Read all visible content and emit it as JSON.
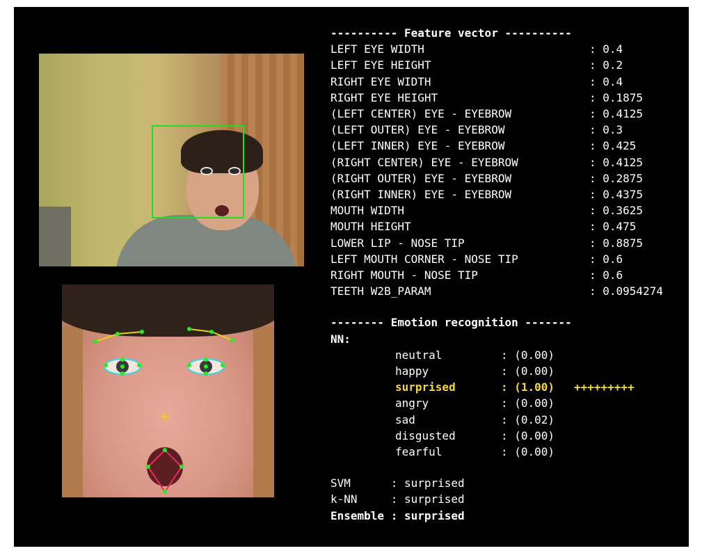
{
  "feature_header": "---------- Feature vector ----------",
  "features": [
    {
      "label": "LEFT EYE WIDTH",
      "value": "0.4"
    },
    {
      "label": "LEFT EYE HEIGHT",
      "value": "0.2"
    },
    {
      "label": "RIGHT EYE WIDTH",
      "value": "0.4"
    },
    {
      "label": "RIGHT EYE HEIGHT",
      "value": "0.1875"
    },
    {
      "label": "(LEFT CENTER) EYE - EYEBROW",
      "value": "0.4125"
    },
    {
      "label": "(LEFT OUTER) EYE - EYEBROW",
      "value": "0.3"
    },
    {
      "label": "(LEFT INNER) EYE - EYEBROW",
      "value": "0.425"
    },
    {
      "label": "(RIGHT CENTER) EYE - EYEBROW",
      "value": "0.4125"
    },
    {
      "label": "(RIGHT OUTER) EYE - EYEBROW",
      "value": "0.2875"
    },
    {
      "label": "(RIGHT INNER) EYE - EYEBROW",
      "value": "0.4375"
    },
    {
      "label": "MOUTH WIDTH",
      "value": "0.3625"
    },
    {
      "label": "MOUTH HEIGHT",
      "value": "0.475"
    },
    {
      "label": "LOWER LIP - NOSE TIP",
      "value": "0.8875"
    },
    {
      "label": "LEFT MOUTH CORNER - NOSE TIP",
      "value": "0.6"
    },
    {
      "label": "RIGHT MOUTH - NOSE TIP",
      "value": "0.6"
    },
    {
      "label": "TEETH W2B_PARAM",
      "value": "0.0954274"
    }
  ],
  "value_prefix": ": ",
  "emotion_header": "-------- Emotion recognition -------",
  "nn_label": "NN:",
  "emotions": [
    {
      "label": "neutral",
      "value": ": (0.00)",
      "bar": ""
    },
    {
      "label": "happy",
      "value": ": (0.00)",
      "bar": ""
    },
    {
      "label": "surprised",
      "value": ": (1.00)",
      "bar": "+++++++++"
    },
    {
      "label": "angry",
      "value": ": (0.00)",
      "bar": ""
    },
    {
      "label": "sad",
      "value": ": (0.02)",
      "bar": ""
    },
    {
      "label": "disgusted",
      "value": ": (0.00)",
      "bar": ""
    },
    {
      "label": "fearful",
      "value": ": (0.00)",
      "bar": ""
    }
  ],
  "highlight_index": 2,
  "results": [
    {
      "text": "SVM      : surprised"
    },
    {
      "text": "k-NN     : surprised"
    },
    {
      "text": "Ensemble : surprised"
    }
  ],
  "colors": {
    "highlight": "#f5d63b",
    "face_box": "#22dd22",
    "landmark": "#22ee22"
  }
}
